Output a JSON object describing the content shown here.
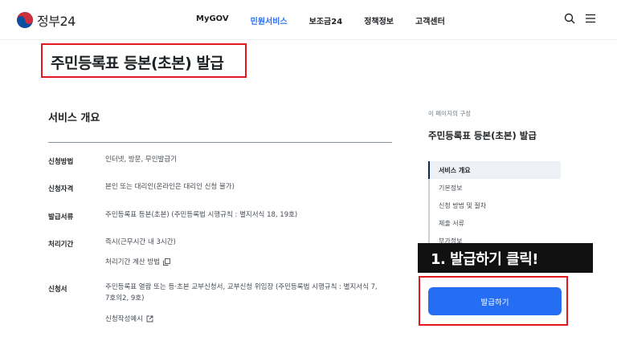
{
  "header": {
    "logo_text": "정부24",
    "nav": [
      "MyGOV",
      "민원서비스",
      "보조금24",
      "정책정보",
      "고객센터"
    ],
    "active_nav": "민원서비스"
  },
  "page_title": "주민등록표 등본(초본) 발급",
  "overview": {
    "title": "서비스 개요",
    "rows": [
      {
        "label": "신청방법",
        "value": "인터넷, 방문, 무인발급기"
      },
      {
        "label": "신청자격",
        "value": "본인 또는 대리인(온라인은 대리인 신청 불가)"
      },
      {
        "label": "발급서류",
        "value": "주민등록표 등본(초본) (주민등록법 시행규칙 : 별지서식 18, 19호)"
      },
      {
        "label": "처리기간",
        "value": "즉시(근무시간 내 3시간)",
        "link": "처리기간 계산 방법"
      },
      {
        "label": "신청서",
        "value_line1": "주민등록표 열람 또는 등·초본 교부신청서, 교부신청 위임장 (주민등록법 시행규칙 : 별지서식 7,",
        "value_line2": "7호의2, 9호)",
        "link": "신청작성예시"
      }
    ]
  },
  "toc": {
    "caption": "이 페이지의 구성",
    "title": "주민등록표 등본(초본) 발급",
    "items": [
      "서비스 개요",
      "기본정보",
      "신청 방법 및 절차",
      "제출 서류",
      "부가정보"
    ]
  },
  "callout_text": "1. 발급하기 클릭!",
  "apply_button_label": "발급하기",
  "colors": {
    "accent": "#256ef4",
    "highlight_red": "#e0191d",
    "callout_bg": "#111111"
  }
}
